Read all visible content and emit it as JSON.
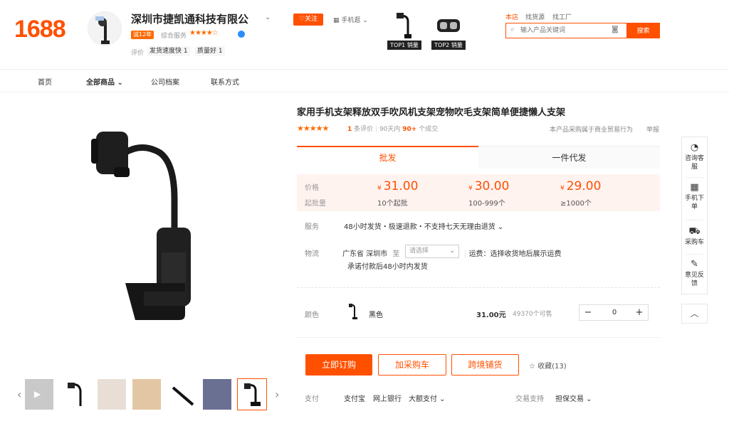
{
  "header": {
    "logo": "1688",
    "shop_name": "深圳市捷凯通科技有限公",
    "year_badge": "诚12年",
    "service_label": "综合服务",
    "service_stars": "★★★★☆",
    "eval_label": "评价",
    "tags": [
      "发货速度快 1",
      "质量好 1"
    ],
    "follow": "关注",
    "phone_shop": "手机逛",
    "top_products": [
      "TOP1 销量",
      "TOP2 销量"
    ],
    "links": [
      "本店",
      "找货源",
      "找工厂"
    ],
    "search_placeholder": "输入产品关键词",
    "search_button": "搜索"
  },
  "nav": [
    "首页",
    "全部商品",
    "公司档案",
    "联系方式"
  ],
  "product": {
    "title": "家用手机支架释放双手吹风机支架宠物吹毛支架简单便捷懒人支架",
    "stars": "★★★★★",
    "eval_count": "1",
    "eval_suffix": "条评价",
    "sold_prefix": "90天内",
    "sold_count": "90+",
    "sold_suffix": "个成交",
    "belongs": "本产品采购属于商业贸易行为",
    "report": "举报"
  },
  "tabs": [
    "批发",
    "一件代发"
  ],
  "pricing": {
    "price_label": "价格",
    "moq_label": "起批量",
    "currency": "¥",
    "tiers": [
      {
        "price": "31.00",
        "moq": "10个起批"
      },
      {
        "price": "30.00",
        "moq": "100-999个"
      },
      {
        "price": "29.00",
        "moq": "≥1000个"
      }
    ]
  },
  "service": {
    "label": "服务",
    "value": "48小时发货・极速退款・不支持七天无理由退货 ⌄"
  },
  "logistics": {
    "label": "物流",
    "from": "广东省 深圳市",
    "to": "至",
    "select_placeholder": "请选择",
    "fee": "运费：选择收货地后展示运费",
    "promise": "承诺付款后48小时内发货"
  },
  "color": {
    "label": "颜色",
    "name": "黑色",
    "price": "31.00元",
    "stock": "49370个可售",
    "qty": "0"
  },
  "actions": {
    "buy": "立即订购",
    "cart": "加采购车",
    "cross": "跨境铺货",
    "fav": "收藏(13)"
  },
  "payment": {
    "label": "支付",
    "items": [
      "支付宝",
      "网上银行",
      "大额支付 ⌄"
    ],
    "trade_label": "交易支持",
    "trade_value": "担保交易 ⌄"
  },
  "sidebar": [
    "咨询客服",
    "手机下单",
    "采购车",
    "意见反馈"
  ],
  "colors": {
    "accent": "#ff5000",
    "price_bg": "#fff3f0"
  }
}
